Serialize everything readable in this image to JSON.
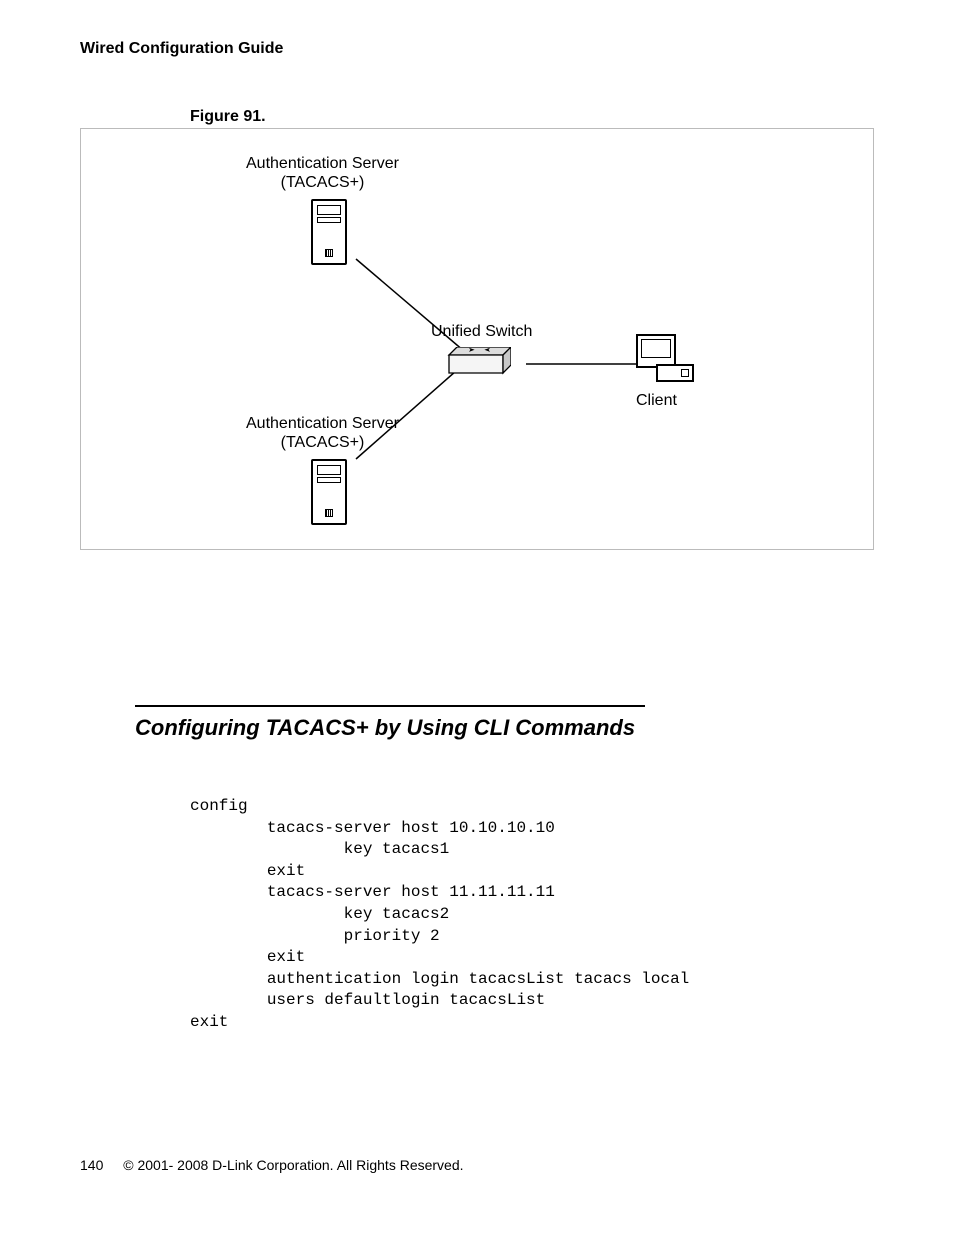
{
  "header": {
    "title": "Wired Configuration Guide"
  },
  "figure": {
    "caption": "Figure 91.",
    "top_server": {
      "line1": "Authentication Server",
      "line2": "(TACACS+)"
    },
    "bottom_server": {
      "line1": "Authentication Server",
      "line2": "(TACACS+)"
    },
    "switch_label": "Unified Switch",
    "client_label": "Client"
  },
  "section": {
    "heading": "Configuring TACACS+ by Using CLI Commands"
  },
  "code": {
    "l0": "config",
    "l1": "        tacacs-server host 10.10.10.10",
    "l2": "                key tacacs1",
    "l3": "        exit",
    "l4": "        tacacs-server host 11.11.11.11",
    "l5": "                key tacacs2",
    "l6": "                priority 2",
    "l7": "        exit",
    "l8": "        authentication login tacacsList tacacs local",
    "l9": "        users defaultlogin tacacsList",
    "l10": "exit"
  },
  "footer": {
    "page_number": "140",
    "copyright": "© 2001- 2008 D-Link Corporation. All Rights Reserved."
  }
}
